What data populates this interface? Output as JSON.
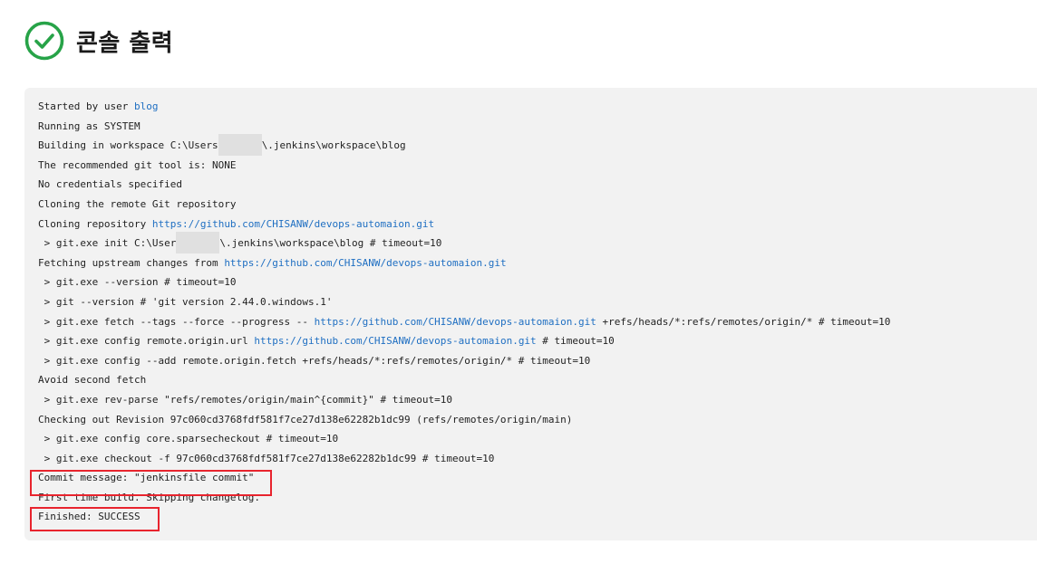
{
  "header": {
    "title": "콘솔 출력",
    "status_icon": "check-circle-icon",
    "status_color": "#27a348"
  },
  "colors": {
    "console_bg": "#f2f2f2",
    "link": "#1f6fc2",
    "highlight": "#e8242e"
  },
  "console": {
    "lines": [
      [
        {
          "t": "Started by user "
        },
        {
          "t": "blog",
          "link": true
        }
      ],
      [
        {
          "t": "Running as SYSTEM"
        }
      ],
      [
        {
          "t": "Building in workspace C:\\Users"
        },
        {
          "redacted": true
        },
        {
          "t": "\\.jenkins\\workspace\\blog"
        }
      ],
      [
        {
          "t": "The recommended git tool is: NONE"
        }
      ],
      [
        {
          "t": "No credentials specified"
        }
      ],
      [
        {
          "t": "Cloning the remote Git repository"
        }
      ],
      [
        {
          "t": "Cloning repository "
        },
        {
          "t": "https://github.com/CHISANW/devops-automaion.git",
          "link": true
        }
      ],
      [
        {
          "t": " > git.exe init C:\\User"
        },
        {
          "redacted": true
        },
        {
          "t": "\\.jenkins\\workspace\\blog # timeout=10"
        }
      ],
      [
        {
          "t": "Fetching upstream changes from "
        },
        {
          "t": "https://github.com/CHISANW/devops-automaion.git",
          "link": true
        }
      ],
      [
        {
          "t": " > git.exe --version # timeout=10"
        }
      ],
      [
        {
          "t": " > git --version # 'git version 2.44.0.windows.1'"
        }
      ],
      [
        {
          "t": " > git.exe fetch --tags --force --progress -- "
        },
        {
          "t": "https://github.com/CHISANW/devops-automaion.git",
          "link": true
        },
        {
          "t": " +refs/heads/*:refs/remotes/origin/* # timeout=10"
        }
      ],
      [
        {
          "t": " > git.exe config remote.origin.url "
        },
        {
          "t": "https://github.com/CHISANW/devops-automaion.git",
          "link": true
        },
        {
          "t": " # timeout=10"
        }
      ],
      [
        {
          "t": " > git.exe config --add remote.origin.fetch +refs/heads/*:refs/remotes/origin/* # timeout=10"
        }
      ],
      [
        {
          "t": "Avoid second fetch"
        }
      ],
      [
        {
          "t": " > git.exe rev-parse \"refs/remotes/origin/main^{commit}\" # timeout=10"
        }
      ],
      [
        {
          "t": "Checking out Revision 97c060cd3768fdf581f7ce27d138e62282b1dc99 (refs/remotes/origin/main)"
        }
      ],
      [
        {
          "t": " > git.exe config core.sparsecheckout # timeout=10"
        }
      ],
      [
        {
          "t": " > git.exe checkout -f 97c060cd3768fdf581f7ce27d138e62282b1dc99 # timeout=10"
        }
      ],
      [
        {
          "t": "Commit message: \"jenkinsfile commit\""
        }
      ],
      [
        {
          "t": "First time build. Skipping changelog."
        }
      ],
      [
        {
          "t": "Finished: SUCCESS"
        }
      ]
    ]
  },
  "highlights": [
    "commit-message",
    "finished-status"
  ]
}
